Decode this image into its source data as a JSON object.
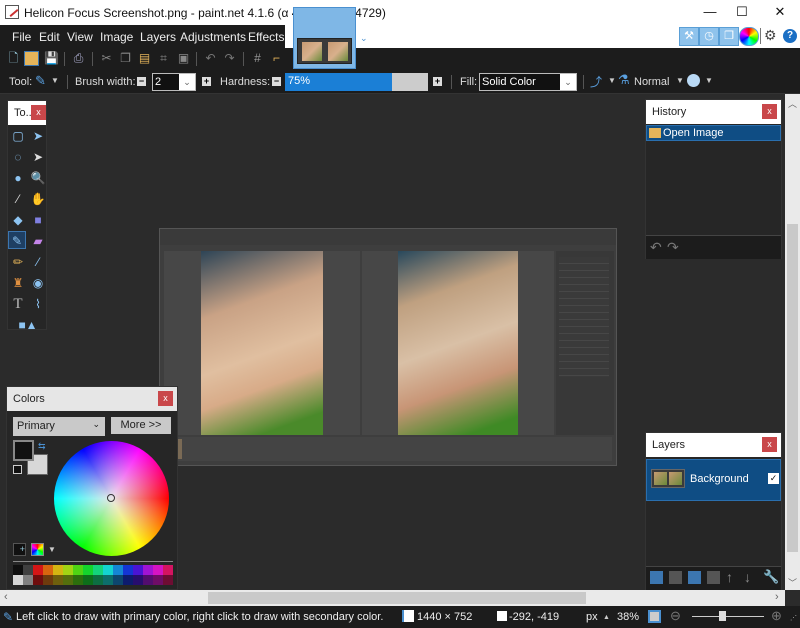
{
  "window": {
    "title": "Helicon Focus Screenshot.png - paint.net 4.1.6 (α 4.106.7000.4729)",
    "minimize": "—",
    "maximize": "☐",
    "close": "✕"
  },
  "menu": [
    "File",
    "Edit",
    "View",
    "Image",
    "Layers",
    "Adjustments",
    "Effects"
  ],
  "tool_options": {
    "tool_label": "Tool:",
    "brush_width_label": "Brush width:",
    "brush_width_value": "2",
    "hardness_label": "Hardness:",
    "hardness_value": "75%",
    "hardness_percent": 75,
    "fill_label": "Fill:",
    "fill_value": "Solid Color",
    "blend_mode": "Normal"
  },
  "panels": {
    "tools": {
      "title": "To...",
      "close": "x"
    },
    "history": {
      "title": "History",
      "close": "x",
      "items": [
        "Open Image"
      ]
    },
    "layers": {
      "title": "Layers",
      "close": "x",
      "items": [
        {
          "name": "Background",
          "visible": true
        }
      ]
    },
    "colors": {
      "title": "Colors",
      "close": "x",
      "mode": "Primary",
      "more_button": "More >>",
      "primary_color": "#111111",
      "secondary_color": "#d8d8d8",
      "palette_top": [
        "#0f0f0f",
        "#404040",
        "#d41616",
        "#d8650f",
        "#d4b512",
        "#a2d414",
        "#4fd414",
        "#14d42d",
        "#14d47b",
        "#14d4d0",
        "#1486d4",
        "#1435d4",
        "#4a14d4",
        "#a014d4",
        "#d414c4",
        "#d41461"
      ],
      "palette_bottom": [
        "#d6d6d6",
        "#808080",
        "#6e0d0d",
        "#6e3a0d",
        "#6e5f0d",
        "#546e0d",
        "#2c6e0d",
        "#0d6e1a",
        "#0d6e42",
        "#0d6e6b",
        "#0d466e",
        "#0d1b6e",
        "#270d6e",
        "#520d6e",
        "#6e0d66",
        "#6e0d33"
      ]
    }
  },
  "status": {
    "hint": "Left click to draw with primary color, right click to draw with secondary color.",
    "image_size": "1440 × 752",
    "cursor_pos": "-292, -419",
    "units": "px",
    "zoom": "38%"
  }
}
